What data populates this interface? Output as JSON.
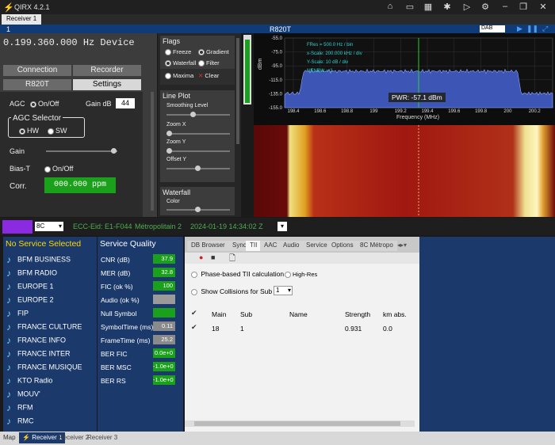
{
  "window": {
    "title": "QIRX 4.2.1",
    "icons": [
      "home-icon",
      "folder-icon",
      "map-icon",
      "satellite-icon",
      "play-icon",
      "gear-icon",
      "minimize-icon",
      "restore-icon",
      "close-icon"
    ]
  },
  "tabs": {
    "receiver1": "Receiver 1"
  },
  "bluebar": {
    "index": "1",
    "device": "R820T",
    "mode": "DAB"
  },
  "left": {
    "frequency": "0.199.360.000 Hz Device",
    "tab_connection": "Connection",
    "tab_recorder": "Recorder",
    "tab_r820t": "R820T",
    "tab_settings": "Settings",
    "agc": "AGC",
    "agc_onoff": "On/Off",
    "gain_db": "Gain dB",
    "gain_val": "44",
    "agc_selector": "AGC Selector",
    "hw": "HW",
    "sw": "SW",
    "gain": "Gain",
    "biast": "Bias-T",
    "biast_onoff": "On/Off",
    "corr": "Corr.",
    "corr_val": "000.000 ppm"
  },
  "flags": {
    "title": "Flags",
    "freeze": "Freeze",
    "gradient": "Gradient",
    "waterfall": "Waterfall",
    "filter": "Filter",
    "maxima": "Maxima",
    "clear": "Clear",
    "lineplot": "Line Plot",
    "smoothing": "Smoothing Level",
    "zoomx": "Zoom X",
    "zoomy": "Zoom Y",
    "offsety": "Offset Y",
    "wf": "Waterfall",
    "color": "Color"
  },
  "spectrum": {
    "title": "R820T",
    "yticks": [
      "-55.0",
      "-75.0",
      "-95.0",
      "-115.0",
      "-135.0",
      "-155.0"
    ],
    "ylabel": "dBm",
    "xticks": [
      "198.4",
      "198.6",
      "198.8",
      "199",
      "199.2",
      "199.4",
      "199.6",
      "199.8",
      "200",
      "200.2"
    ],
    "xlabel": "Frequency (MHz)",
    "info1": "FRes = 500.0 Hz / bin",
    "info2": "x-Scale: 200.000 kHz / div",
    "info3": "Y-Scale: 10 dB / div",
    "info4": "NENBW = 2",
    "pwr": "PWR: -57.1 dBm"
  },
  "mid": {
    "bc": "8C",
    "ecc": "ECC-Eid: E1-F044",
    "ensemble": "Métropolitain 2",
    "datetime": "2024-01-19  14:34:02 Z"
  },
  "services": {
    "header": "No Service Selected",
    "items": [
      "BFM BUSINESS",
      "BFM RADIO",
      "EUROPE 1",
      "EUROPE 2",
      "FIP",
      "FRANCE CULTURE",
      "FRANCE INFO",
      "FRANCE INTER",
      "FRANCE MUSIQUE",
      "KTO Radio",
      "MOUV'",
      "RFM",
      "RMC"
    ]
  },
  "quality": {
    "header": "Service Quality",
    "rows": [
      {
        "label": "CNR (dB)",
        "value": "37.9",
        "color": "#1aa01a"
      },
      {
        "label": "MER (dB)",
        "value": "32.8",
        "color": "#1aa01a"
      },
      {
        "label": "FIC (ok %)",
        "value": "100",
        "color": "#1aa01a"
      },
      {
        "label": "Audio (ok %)",
        "value": "",
        "color": "#9a9a9a"
      },
      {
        "label": "Null Symbol",
        "value": "",
        "color": "#1aa01a"
      },
      {
        "label": "SymbolTime (ms)",
        "value": "0.11",
        "color": "#8a8a8a"
      },
      {
        "label": "FrameTime (ms)",
        "value": "25.2",
        "color": "#8a8a8a"
      },
      {
        "label": "BER FIC",
        "value": "0.0e+0",
        "color": "#1aa01a"
      },
      {
        "label": "BER MSC",
        "value": "-1.0e+0",
        "color": "#1aa01a"
      },
      {
        "label": "BER RS",
        "value": "-1.0e+0",
        "color": "#1aa01a"
      }
    ]
  },
  "tii": {
    "tabs": [
      "DB Browser",
      "Sync",
      "TII",
      "AAC",
      "Audio",
      "Service",
      "Options",
      "8C Métropo"
    ],
    "phase": "Phase-based TII calculation",
    "highres": "High-Res",
    "collisions": "Show Collisions for Sub Id",
    "collision_val": "1",
    "cols": [
      "Main",
      "Sub",
      "Name",
      "Strength",
      "km abs."
    ],
    "row": {
      "main": "18",
      "sub": "1",
      "name": "",
      "strength": "0.931",
      "km": "0.0"
    }
  },
  "status": {
    "items": [
      "Map",
      "Receiver 1",
      "Receiver 2",
      "Receiver 3"
    ]
  }
}
